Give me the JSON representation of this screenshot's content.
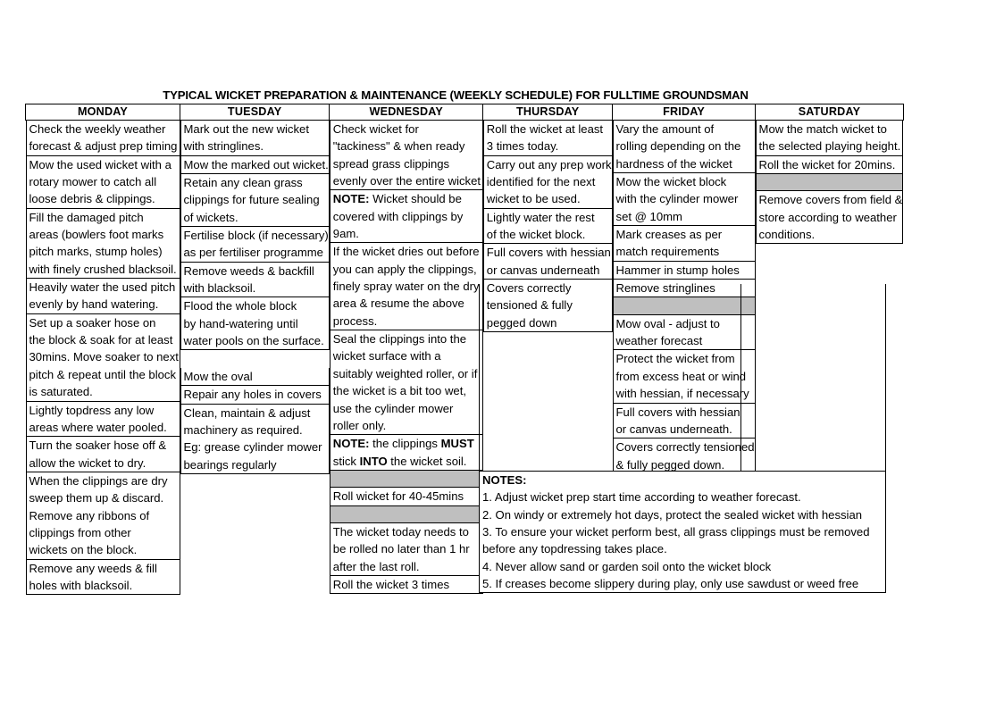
{
  "document": {
    "title": "TYPICAL WICKET PREPARATION & MAINTENANCE (WEEKLY SCHEDULE) FOR FULLTIME GROUNDSMAN"
  },
  "table": {
    "headers": [
      "MONDAY",
      "TUESDAY",
      "WEDNESDAY",
      "THURSDAY",
      "FRIDAY",
      "SATURDAY"
    ],
    "shaded_color": "#bfbfbf",
    "columns": {
      "monday": [
        {
          "type": "text",
          "lines": [
            "Check the weekly weather",
            "forecast & adjust prep timing"
          ]
        },
        {
          "type": "text",
          "lines": [
            "Mow the used wicket with a",
            "rotary mower to catch all",
            "loose debris & clippings."
          ]
        },
        {
          "type": "text",
          "lines": [
            "Fill the damaged pitch",
            "areas (bowlers foot marks",
            "pitch marks, stump holes)",
            "with finely crushed blacksoil."
          ]
        },
        {
          "type": "text",
          "lines": [
            "Heavily water the used pitch",
            "evenly by hand watering."
          ]
        },
        {
          "type": "text",
          "lines": [
            "Set up a soaker hose on",
            "the block & soak for at least",
            "30mins. Move soaker to next",
            "pitch & repeat until the block",
            "is saturated."
          ]
        },
        {
          "type": "text",
          "lines": [
            "Lightly topdress any low",
            "areas where water pooled."
          ]
        },
        {
          "type": "text",
          "lines": [
            "Turn the soaker hose off &",
            "allow the wicket to dry."
          ]
        },
        {
          "type": "text",
          "lines": [
            "When the clippings are dry",
            "sweep them up & discard.",
            "Remove any ribbons of",
            "clippings from other",
            "wickets on the block."
          ]
        },
        {
          "type": "text",
          "lines": [
            "Remove any weeds & fill",
            "holes with blacksoil."
          ]
        }
      ],
      "tuesday": [
        {
          "type": "text",
          "lines": [
            "Mark out the new wicket",
            "with stringlines."
          ]
        },
        {
          "type": "text",
          "lines": [
            "Mow the marked out wicket."
          ]
        },
        {
          "type": "text",
          "lines": [
            "Retain any clean grass",
            "clippings for future sealing",
            "of wickets."
          ]
        },
        {
          "type": "text",
          "lines": [
            "Fertilise block (if necessary)",
            "as per fertiliser programme"
          ]
        },
        {
          "type": "text",
          "lines": [
            "Remove weeds & backfill",
            "with blacksoil."
          ]
        },
        {
          "type": "text",
          "lines": [
            "Flood the whole block",
            "by hand-watering until",
            "water pools on the surface."
          ]
        },
        {
          "type": "gap",
          "lines": []
        },
        {
          "type": "text",
          "lines": [
            "Mow the oval"
          ]
        },
        {
          "type": "text",
          "lines": [
            "Repair any holes in covers"
          ]
        },
        {
          "type": "text",
          "lines": [
            "Clean, maintain & adjust",
            "machinery as required.",
            "Eg: grease cylinder mower",
            "bearings regularly"
          ]
        }
      ],
      "wednesday": [
        {
          "type": "text",
          "lines": [
            "Check wicket for",
            "\"tackiness\" & when ready",
            "spread grass clippings",
            "evenly over the entire wicket"
          ]
        },
        {
          "type": "rich",
          "lines": [
            [
              "NOTE:",
              " Wicket should be"
            ],
            [
              "",
              "covered with clippings by"
            ],
            [
              "",
              "9am."
            ]
          ]
        },
        {
          "type": "text",
          "lines": [
            "If the wicket dries out before",
            "you can apply the clippings,",
            "finely spray water on the dry",
            "area & resume the above",
            "process."
          ]
        },
        {
          "type": "text",
          "lines": [
            "Seal the clippings into the",
            "wicket surface with a",
            "suitably weighted roller, or if",
            "the wicket is a bit too wet,",
            "use the cylinder mower",
            "roller only."
          ]
        },
        {
          "type": "rich",
          "lines": [
            [
              "NOTE:",
              " the clippings ",
              "MUST"
            ],
            [
              "",
              "stick ",
              "INTO",
              " the wicket soil."
            ]
          ]
        },
        {
          "type": "shaded",
          "lines": []
        },
        {
          "type": "text",
          "lines": [
            "Roll wicket for 40-45mins"
          ]
        },
        {
          "type": "shaded",
          "lines": []
        },
        {
          "type": "text",
          "lines": [
            "The wicket today needs to",
            "be rolled no later than 1 hr",
            "after the last roll."
          ]
        },
        {
          "type": "text",
          "lines": [
            "Roll the wicket 3 times"
          ]
        }
      ],
      "thursday": [
        {
          "type": "text",
          "lines": [
            "Roll the wicket at least",
            "3 times today."
          ]
        },
        {
          "type": "text",
          "lines": [
            "Carry out any prep work",
            "identified for the next",
            "wicket to be used."
          ]
        },
        {
          "type": "text",
          "lines": [
            "Lightly water the rest",
            "of the wicket block."
          ]
        },
        {
          "type": "text",
          "lines": [
            "Full covers with hessian",
            "or canvas underneath"
          ]
        },
        {
          "type": "text",
          "lines": [
            "Covers correctly",
            "tensioned & fully",
            "pegged down"
          ]
        }
      ],
      "friday": [
        {
          "type": "text",
          "lines": [
            "Vary the amount of",
            "rolling depending on the",
            "hardness of the wicket"
          ]
        },
        {
          "type": "text",
          "lines": [
            "Mow the wicket block",
            "with the cylinder mower",
            "set @ 10mm"
          ]
        },
        {
          "type": "text",
          "lines": [
            "Mark creases as per",
            "match requirements"
          ]
        },
        {
          "type": "text",
          "lines": [
            "Hammer in stump holes"
          ]
        },
        {
          "type": "text",
          "lines": [
            "Remove stringlines"
          ]
        },
        {
          "type": "shaded",
          "lines": []
        },
        {
          "type": "text",
          "lines": [
            "Mow oval - adjust to",
            "weather forecast"
          ]
        },
        {
          "type": "text",
          "lines": [
            "Protect the wicket from",
            "from excess heat or wind",
            "with hessian, if necessary"
          ]
        },
        {
          "type": "text",
          "lines": [
            "Full covers with hessian",
            "or canvas underneath."
          ]
        },
        {
          "type": "text",
          "lines": [
            "Covers correctly tensioned",
            "& fully pegged down."
          ]
        }
      ],
      "saturday": [
        {
          "type": "text",
          "lines": [
            "Mow the match wicket to",
            "the selected playing height."
          ]
        },
        {
          "type": "text",
          "lines": [
            "Roll the wicket for 20mins."
          ]
        },
        {
          "type": "shaded",
          "lines": []
        },
        {
          "type": "text",
          "lines": [
            "Remove covers from field &",
            "store according to weather",
            "conditions."
          ]
        }
      ]
    }
  },
  "notes": {
    "heading": "NOTES:",
    "items": [
      "1. Adjust wicket prep start time according to weather forecast.",
      "2. On windy or extremely hot days, protect the sealed wicket with hessian",
      "3. To ensure your wicket perform best, all grass clippings must be removed",
      "before any topdressing takes place.",
      "4. Never allow sand or garden soil onto the wicket block",
      "5. If creases become slippery during play, only use sawdust or weed free"
    ]
  }
}
